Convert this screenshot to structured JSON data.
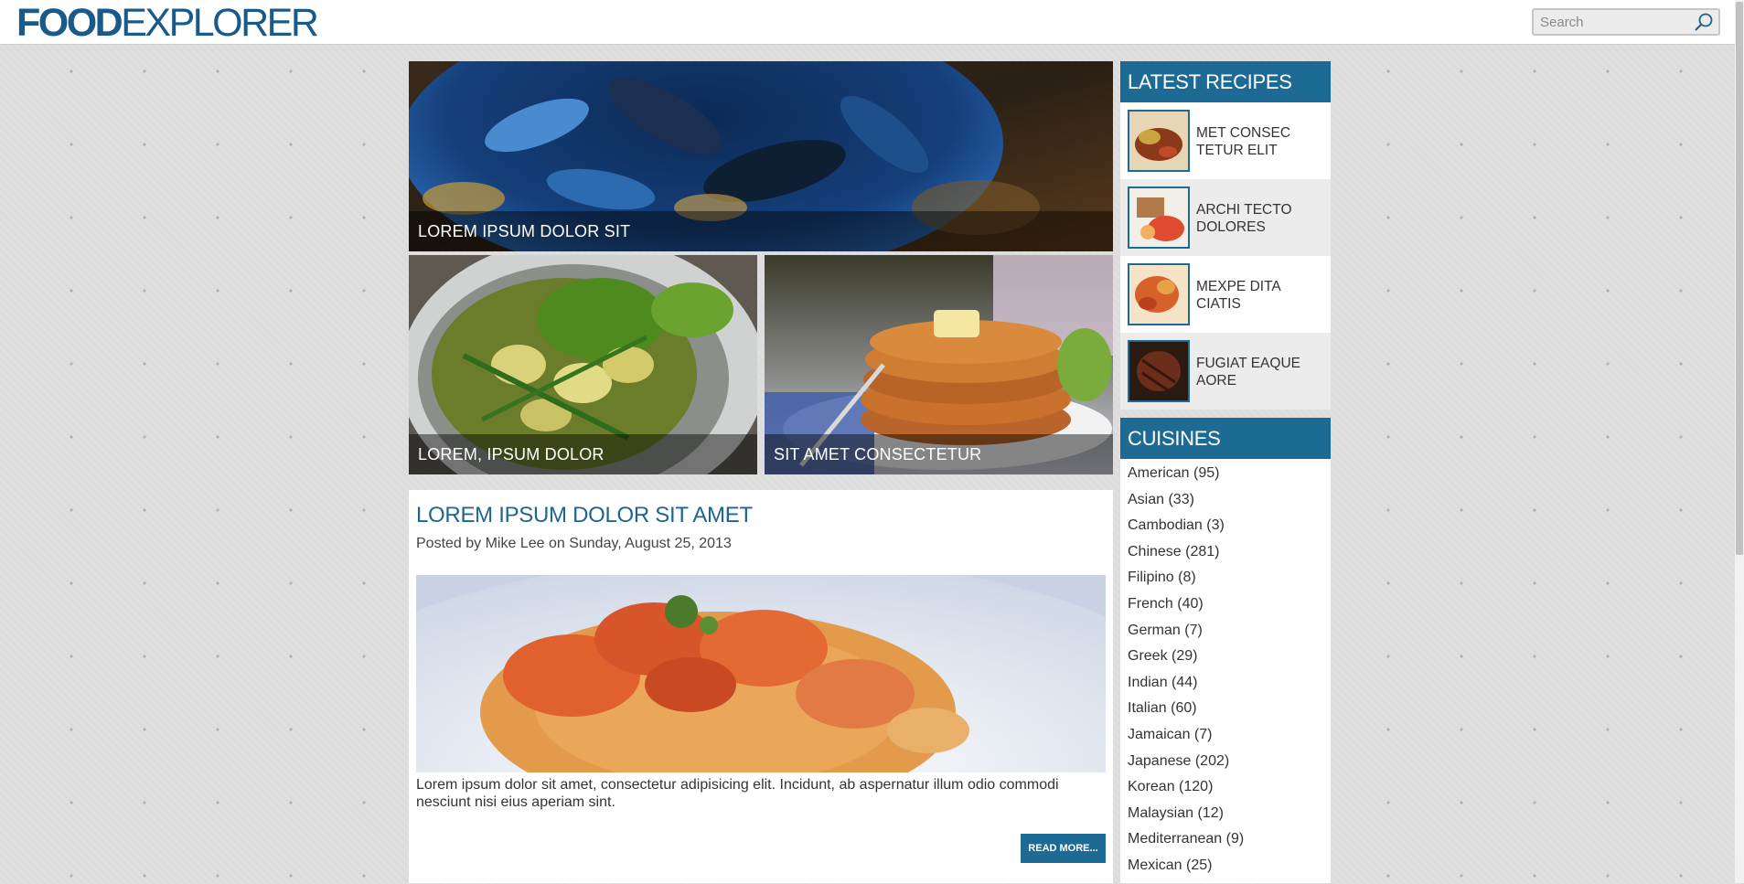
{
  "header": {
    "logo_bold": "FOOD",
    "logo_regular": "EXPLORER",
    "search_placeholder": "Search"
  },
  "featured": [
    {
      "caption": "LOREM IPSUM DOLOR SIT"
    },
    {
      "caption": "LOREM, IPSUM DOLOR"
    },
    {
      "caption": "SIT AMET CONSECTETUR"
    }
  ],
  "post": {
    "title": "LOREM IPSUM DOLOR SIT AMET",
    "meta": "Posted by Mike Lee on Sunday, August 25, 2013",
    "excerpt": "Lorem ipsum dolor sit amet, consectetur adipisicing elit. Incidunt, ab aspernatur illum odio commodi nesciunt nisi eius aperiam sint.",
    "read_more": "READ MORE..."
  },
  "sidebar": {
    "latest_title": "LATEST RECIPES",
    "recipes": [
      {
        "label": "MET CONSEC TETUR ELIT"
      },
      {
        "label": "ARCHI TECTO DOLORES"
      },
      {
        "label": "MEXPE DITA CIATIS"
      },
      {
        "label": "FUGIAT EAQUE AORE"
      }
    ],
    "cuisines_title": "CUISINES",
    "cuisines": [
      "American (95)",
      "Asian (33)",
      "Cambodian (3)",
      "Chinese (281)",
      "Filipino (8)",
      "French (40)",
      "German (7)",
      "Greek (29)",
      "Indian (44)",
      "Italian (60)",
      "Jamaican (7)",
      "Japanese (202)",
      "Korean (120)",
      "Malaysian (12)",
      "Mediterranean (9)",
      "Mexican (25)"
    ]
  },
  "colors": {
    "brand_blue": "#1d6a94",
    "page_bg": "#dcdcdc",
    "alt_row": "#ececec"
  }
}
